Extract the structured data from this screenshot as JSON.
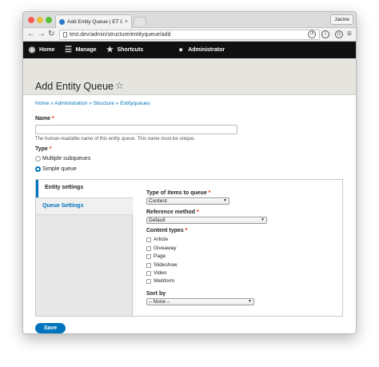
{
  "browser": {
    "tab_title": "Add Entity Queue | ET Onl",
    "tab_close": "×",
    "profile": "Jacine",
    "url": "test.dev/admin/structure/entityqueue/add"
  },
  "admin_toolbar": {
    "home": "Home",
    "manage": "Manage",
    "shortcuts": "Shortcuts",
    "user": "Administrator"
  },
  "page": {
    "title": "Add Entity Queue",
    "breadcrumb": "Home » Administration » Structure » Entityqueues"
  },
  "form": {
    "name_label": "Name",
    "name_value": "",
    "name_description": "The human-readable name of this entity queue. This name must be unique.",
    "type_label": "Type",
    "type_options": [
      "Multiple subqueues",
      "Simple queue"
    ],
    "type_selected": "Simple queue",
    "required_marker": "*"
  },
  "vertical_tabs": {
    "tabs": [
      "Entity settings",
      "Queue Settings"
    ],
    "active": "Entity settings",
    "type_of_items_label": "Type of items to queue",
    "type_of_items_value": "Content",
    "reference_method_label": "Reference method",
    "reference_method_value": "Default",
    "content_types_label": "Content types",
    "content_types": [
      "Article",
      "Giveaway",
      "Page",
      "Slideshow",
      "Video",
      "Webform"
    ],
    "sort_by_label": "Sort by",
    "sort_by_value": "– None –"
  },
  "actions": {
    "save": "Save"
  },
  "colors": {
    "accent": "#0074bd",
    "required": "#e62600",
    "admin_bar": "#101010"
  }
}
